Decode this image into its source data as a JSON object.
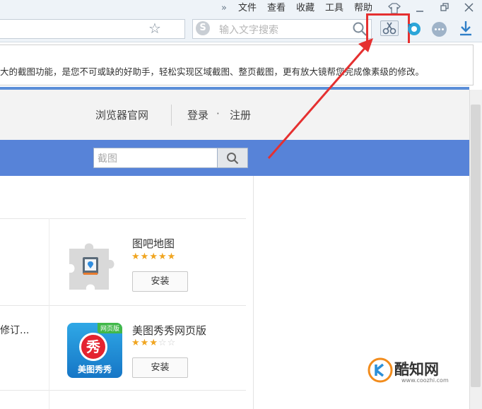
{
  "menu": {
    "chevron": "»",
    "items": [
      "文件",
      "查看",
      "收藏",
      "工具",
      "帮助"
    ],
    "icons": [
      "shirt-icon",
      "minimize-icon",
      "restore-icon",
      "close-icon"
    ]
  },
  "toolbar": {
    "search_placeholder": "输入文字搜索",
    "icons": [
      "star-icon",
      "sogou-logo-icon",
      "magnifier-icon",
      "scissors-icon",
      "globe-icon",
      "more-icon",
      "download-icon"
    ]
  },
  "tooltip": {
    "text": "大的截图功能，是您不可或缺的好助手，轻松实现区域截图、整页截图，更有放大镜帮您完成像素级的修改。"
  },
  "site_header": {
    "official_site": "浏览器官网",
    "login": "登录",
    "separator": "·",
    "register": "注册"
  },
  "site_search": {
    "value": "截图"
  },
  "apps": [
    {
      "title": "图吧地图",
      "rating": 5,
      "max_rating": 5,
      "install": "安装"
    },
    {
      "title": "美图秀秀网页版",
      "rating": 3,
      "max_rating": 5,
      "install": "安装",
      "badge_tag": "网页版",
      "badge_char": "秀",
      "badge_text": "美图秀秀"
    }
  ],
  "left_partial_text": "修订...",
  "watermark": {
    "name": "酷知网",
    "url": "www.coozhi.com"
  },
  "colors": {
    "accent_blue": "#5783d8",
    "highlight_red": "#e53030",
    "star_gold": "#f0a520"
  }
}
